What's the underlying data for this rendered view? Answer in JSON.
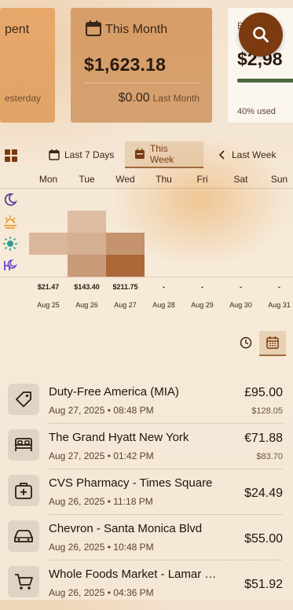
{
  "summary": {
    "left_card": {
      "label": "pent",
      "sub": "esterday"
    },
    "mid_card": {
      "title": "This Month",
      "amount": "$1,623.18",
      "last_amount": "$0.00",
      "last_label": "Last Month"
    },
    "right_card": {
      "letter": "B",
      "amount": "$2,98",
      "used_label": "40% used",
      "used_fraction": 0.4
    }
  },
  "tabs": [
    "Last 7 Days",
    "This Week",
    "Last Week"
  ],
  "active_tab": "This Week",
  "heatmap": {
    "days": [
      "Mon",
      "Tue",
      "Wed",
      "Thu",
      "Fri",
      "Sat",
      "Sun"
    ],
    "rows": [
      "night-icon",
      "sunrise-icon",
      "day-icon",
      "evening-icon"
    ],
    "totals": [
      "$21.47",
      "$143.40",
      "$211.75",
      "-",
      "-",
      "-",
      "-"
    ],
    "dates": [
      "Aug 25",
      "Aug 26",
      "Aug 27",
      "Aug 28",
      "Aug 29",
      "Aug 30",
      "Aug 31"
    ],
    "intensity": [
      [
        0,
        0,
        0,
        0,
        0,
        0,
        0
      ],
      [
        0,
        0.3,
        0,
        0,
        0,
        0,
        0
      ],
      [
        0.35,
        0.4,
        0.6,
        0,
        0,
        0,
        0
      ],
      [
        0,
        0.55,
        0.9,
        0,
        0,
        0,
        0
      ]
    ],
    "base_color": "#a55a28"
  },
  "transactions": [
    {
      "icon": "tag-icon",
      "name": "Duty-Free America (MIA)",
      "meta": "Aug 27, 2025 • 08:48 PM",
      "amount": "£95.00",
      "original": "$128.05"
    },
    {
      "icon": "bed-icon",
      "name": "The Grand Hyatt New York",
      "meta": "Aug 27, 2025 • 01:42 PM",
      "amount": "€71.88",
      "original": "$83.70"
    },
    {
      "icon": "medical-kit-icon",
      "name": "CVS Pharmacy - Times Square",
      "meta": "Aug 26, 2025 • 11:18 PM",
      "amount": "$24.49",
      "original": ""
    },
    {
      "icon": "car-icon",
      "name": "Chevron - Santa Monica Blvd",
      "meta": "Aug 26, 2025 • 10:48 PM",
      "amount": "$55.00",
      "original": ""
    },
    {
      "icon": "cart-icon",
      "name": "Whole Foods Market - Lamar Blvd",
      "meta": "Aug 26, 2025 • 04:36 PM",
      "amount": "$51.92",
      "original": ""
    }
  ],
  "colors": {
    "accent": "#7b3a10",
    "budget_bar": "#4c6a3f"
  }
}
